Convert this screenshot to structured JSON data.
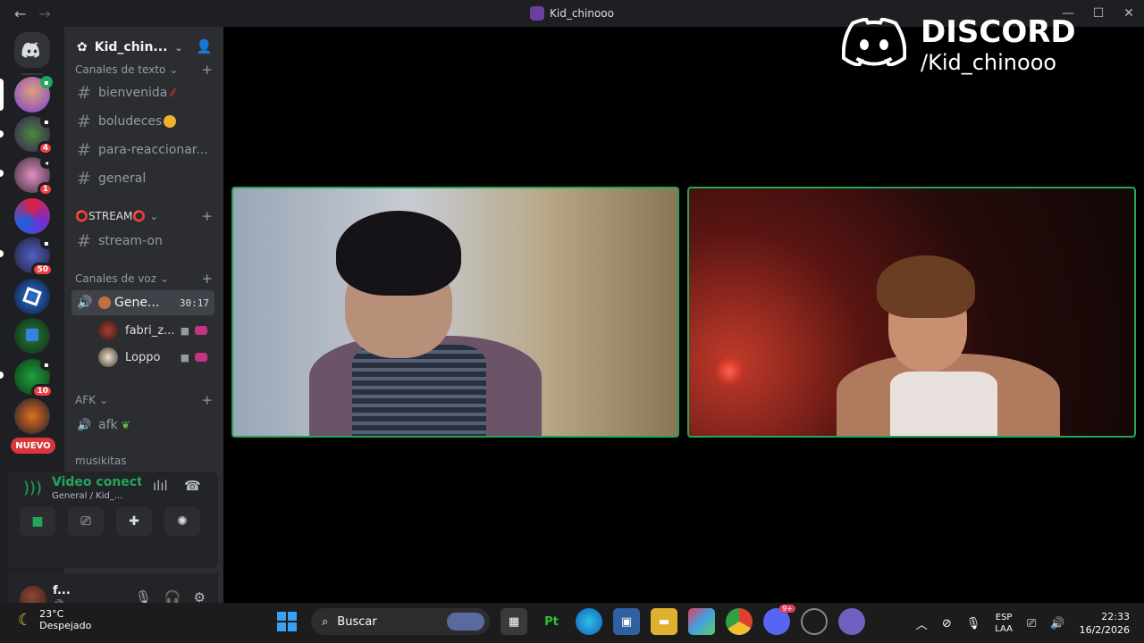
{
  "titlebar": {
    "title": "Kid_chinooo",
    "back": "←",
    "forward": "→",
    "minimize": "—",
    "maximize": "☐",
    "close": "✕"
  },
  "rail": {
    "nuevo": "NUEVO",
    "badges": [
      "4",
      "1",
      "50",
      "10"
    ]
  },
  "sidebar": {
    "guild_name": "Kid_chin...",
    "categories": {
      "text": "Canales de texto",
      "stream": "⭕STREAM⭕",
      "voice": "Canales de voz",
      "afk": "AFK",
      "cut": "musikitas"
    },
    "channels": {
      "bienvenida": "bienvenida",
      "boludeces": "boludeces",
      "reaccionar": "para-reaccionar...",
      "general": "general",
      "stream_on": "stream-on",
      "voice_general": "Gene...",
      "voice_timer": "30:17",
      "afk": "afk"
    },
    "voice_users": [
      "fabri_z...",
      "Loppo"
    ]
  },
  "voice_panel": {
    "status": "Video conectado",
    "location": "General / Kid_..."
  },
  "user_panel": {
    "name": "f...",
    "sub": "🔊 •"
  },
  "watermark": {
    "brand": "DISCORD",
    "handle": "/Kid_chinooo"
  },
  "taskbar": {
    "temp": "23°C",
    "condition": "Despejado",
    "search": "Buscar",
    "lang1": "ESP",
    "lang2": "LAA",
    "time": "22:33",
    "date": "16/2/2026",
    "discord_badge": "9+"
  },
  "colors": {
    "accent_green": "#23a55a",
    "sidebar_bg": "#2b2d31",
    "rail_bg": "#1e1f22",
    "badge_red": "#f23f43"
  }
}
